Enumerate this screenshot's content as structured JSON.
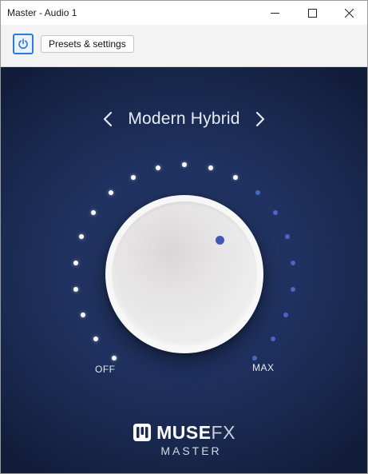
{
  "window": {
    "title": "Master - Audio 1",
    "controls": {
      "minimize": "minimize-icon",
      "maximize": "maximize-icon",
      "close": "close-icon"
    }
  },
  "toolbar": {
    "power_icon": "power-icon",
    "presets_label": "Presets & settings"
  },
  "plugin": {
    "preset_name": "Modern Hybrid",
    "prev_icon": "chevron-left-icon",
    "next_icon": "chevron-right-icon",
    "knob": {
      "min_label": "OFF",
      "max_label": "MAX",
      "level": 0.6,
      "segments": 21
    },
    "brand": {
      "mark_icon": "musefx-logo-icon",
      "muse": "MUSE",
      "fx": "FX",
      "sub": "MASTER"
    }
  },
  "colors": {
    "panel_bg": "#1f3160",
    "accent_blue": "#4158b4",
    "active_dot": "#ffffff",
    "inactive_dot": "#4a66c4",
    "power_border": "#2f7ad9"
  }
}
